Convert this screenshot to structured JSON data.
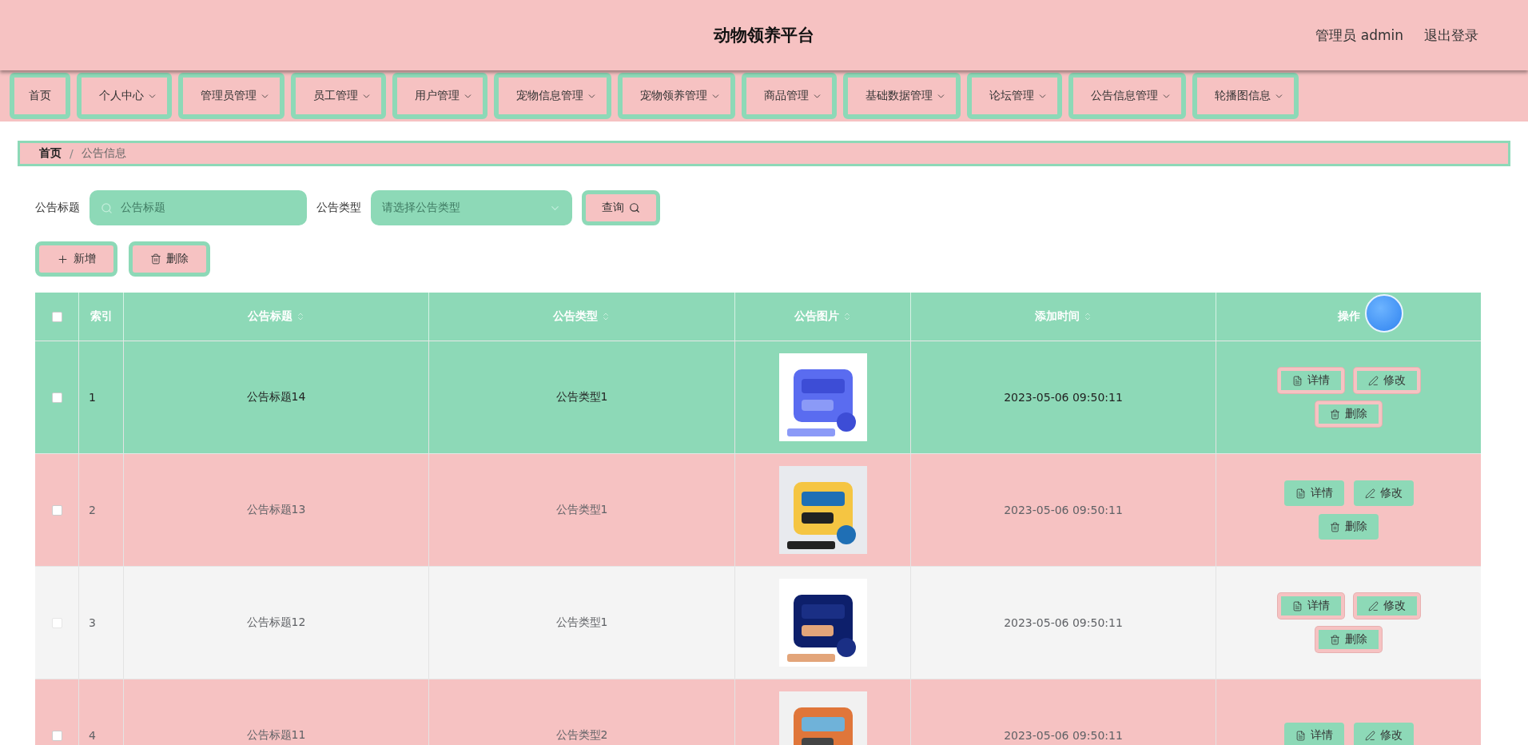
{
  "header": {
    "title": "动物领养平台",
    "user": "管理员 admin",
    "logout": "退出登录"
  },
  "nav": [
    {
      "label": "首页",
      "dropdown": false
    },
    {
      "label": "个人中心",
      "dropdown": true
    },
    {
      "label": "管理员管理",
      "dropdown": true
    },
    {
      "label": "员工管理",
      "dropdown": true
    },
    {
      "label": "用户管理",
      "dropdown": true
    },
    {
      "label": "宠物信息管理",
      "dropdown": true
    },
    {
      "label": "宠物领养管理",
      "dropdown": true
    },
    {
      "label": "商品管理",
      "dropdown": true
    },
    {
      "label": "基础数据管理",
      "dropdown": true
    },
    {
      "label": "论坛管理",
      "dropdown": true
    },
    {
      "label": "公告信息管理",
      "dropdown": true
    },
    {
      "label": "轮播图信息",
      "dropdown": true
    }
  ],
  "breadcrumb": {
    "items": [
      "首页",
      "公告信息"
    ],
    "separator": "/"
  },
  "search": {
    "title_label": "公告标题",
    "title_placeholder": "公告标题",
    "type_label": "公告类型",
    "type_placeholder": "请选择公告类型",
    "query_button": "查询"
  },
  "actions": {
    "add": "新增",
    "delete": "删除"
  },
  "table": {
    "select_all_checked": false,
    "columns": [
      {
        "label": "索引",
        "sortable": false
      },
      {
        "label": "公告标题",
        "sortable": true
      },
      {
        "label": "公告类型",
        "sortable": true
      },
      {
        "label": "公告图片",
        "sortable": true
      },
      {
        "label": "添加时间",
        "sortable": true
      },
      {
        "label": "操作",
        "sortable": false
      }
    ],
    "rows": [
      {
        "kind": "hovered",
        "checked": false,
        "index": "1",
        "title": "公告标题14",
        "type": "公告类型1",
        "image": {
          "kind": "picture"
        },
        "time": "2023-05-06 09:50:11",
        "buttons": [
          "详情",
          "修改",
          "删除"
        ]
      },
      {
        "kind": "pink",
        "checked": false,
        "index": "2",
        "title": "公告标题13",
        "type": "公告类型1",
        "image": {
          "kind": "picture"
        },
        "time": "2023-05-06 09:50:11",
        "buttons": [
          "详情",
          "修改",
          "删除"
        ]
      },
      {
        "kind": "grey",
        "checked": false,
        "index": "3",
        "title": "公告标题12",
        "type": "公告类型1",
        "image": {
          "kind": "picture"
        },
        "time": "2023-05-06 09:50:11",
        "buttons": [
          "详情",
          "修改",
          "删除"
        ]
      },
      {
        "kind": "pink",
        "checked": false,
        "index": "4",
        "title": "公告标题11",
        "type": "公告类型2",
        "image": {
          "kind": "picture"
        },
        "time": "2023-05-06 09:50:11",
        "buttons": [
          "详情",
          "修改"
        ]
      }
    ]
  }
}
